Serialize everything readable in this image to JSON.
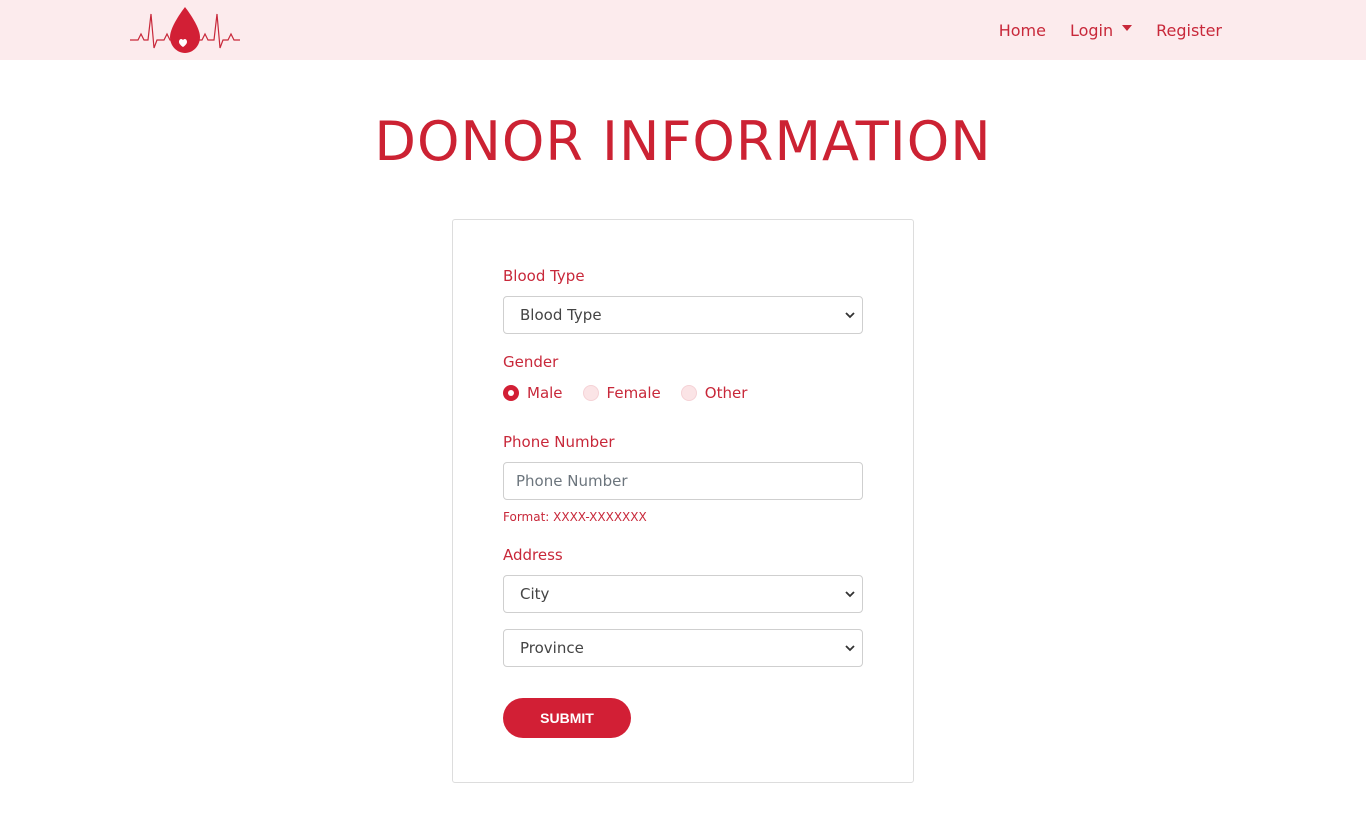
{
  "nav": {
    "logo_icon": "blood-drop-heartbeat-icon",
    "links": [
      {
        "label": "Home"
      },
      {
        "label": "Login"
      },
      {
        "label": "Register"
      }
    ]
  },
  "page": {
    "title": "DONOR INFORMATION"
  },
  "form": {
    "blood_type": {
      "label": "Blood Type",
      "value": "Blood Type"
    },
    "gender": {
      "label": "Gender",
      "options": [
        "Male",
        "Female",
        "Other"
      ],
      "selected": "Male"
    },
    "phone": {
      "label": "Phone Number",
      "placeholder": "Phone Number",
      "hint": "Format: XXXX-XXXXXXX"
    },
    "address": {
      "label": "Address",
      "city": "City",
      "province": "Province"
    },
    "submit_label": "SUBMIT"
  },
  "colors": {
    "accent": "#d21f35",
    "nav_bg": "#fcebed"
  }
}
